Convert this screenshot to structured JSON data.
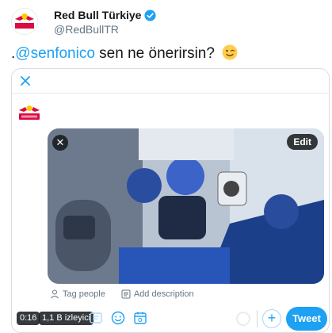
{
  "author": {
    "name": "Red Bull Türkiye",
    "handle": "@RedBullTR",
    "verified_icon": "verified-badge-icon",
    "avatar_brand": "Red Bull"
  },
  "tweet": {
    "prefix": ".",
    "mention": "@senfonico",
    "text": " sen ne önerirsin?",
    "emoji": "winking-face"
  },
  "composer": {
    "close_icon": "close-icon",
    "logo_brand": "Red Bull",
    "media": {
      "remove_icon": "close-icon",
      "remove_glyph": "✕",
      "edit_label": "Edit"
    },
    "tag_people_label": "Tag people",
    "add_description_label": "Add description",
    "video_duration": "0:16",
    "view_count": "1,1 B izleyici",
    "plus_glyph": "+",
    "tweet_button_label": "Tweet"
  },
  "colors": {
    "accent": "#1da1f2",
    "text": "#14171a",
    "muted": "#657786",
    "brand_red": "#db0a40",
    "brand_yellow": "#ffc906"
  }
}
